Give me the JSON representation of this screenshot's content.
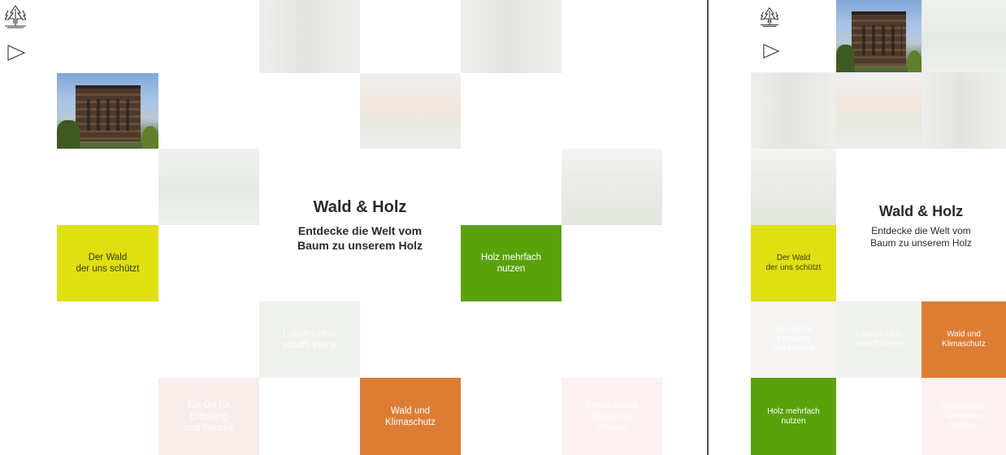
{
  "title": "Wald & Holz",
  "subtitle": "Entdecke die Welt vom\nBaum zu unserem Holz",
  "icons": {
    "tree": "tree-icon",
    "play": "play-icon"
  },
  "colors": {
    "yellow": "#dfe012",
    "green": "#5aa20c",
    "orange": "#dd7d34"
  },
  "tiles": {
    "wald_schutz": "Der Wald\nder uns schützt",
    "holz_mehrfach": "Holz mehrfach\nnutzen",
    "wald_klima": "Wald und\nKlimaschutz",
    "lokales_holz": "Lokales Holz\nschafft Werte",
    "erholung": "Ein Ort für\nErholung\nund Freizeit",
    "erholung_right": "Ein Ort für\nErholung\nund Freizeit",
    "symbolische": "Symbolische\nWerte des\nWaldes",
    "wald_schutz_right": "Der Wald\nder uns schützt",
    "lokales_holz_right": "Lokales Holz\nschafft Werte",
    "wald_klima_right": "Wald und\nKlimaschutz",
    "holz_mehrfach_right": "Holz mehrfach\nnutzen",
    "symbolische_right": "Symbolische\nWerte des\nWaldes"
  }
}
